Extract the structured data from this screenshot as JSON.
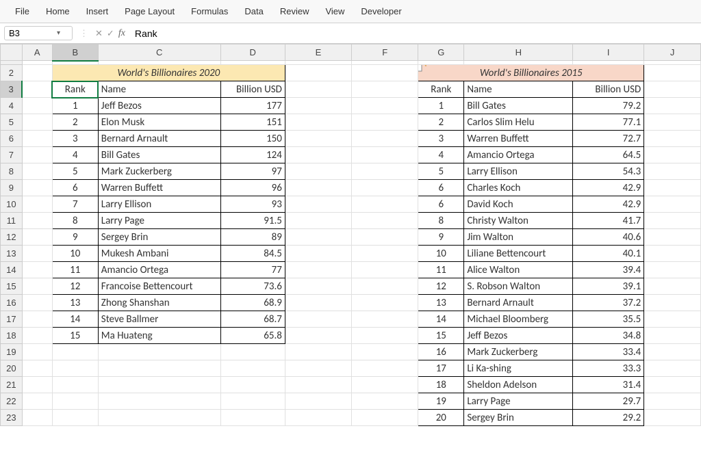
{
  "ribbon": [
    "File",
    "Home",
    "Insert",
    "Page Layout",
    "Formulas",
    "Data",
    "Review",
    "View",
    "Developer"
  ],
  "namebox": "B3",
  "formula": "Rank",
  "columns": [
    "A",
    "B",
    "C",
    "D",
    "E",
    "F",
    "G",
    "H",
    "I",
    "J"
  ],
  "selectedCell": "B3",
  "titles": {
    "t2020": "World's Billionaires 2020",
    "t2015": "World's Billionaires 2015"
  },
  "headers": {
    "rank": "Rank",
    "name": "Name",
    "usd": "Billion USD"
  },
  "table2020": [
    {
      "r": 1,
      "n": "Jeff Bezos",
      "v": "177"
    },
    {
      "r": 2,
      "n": "Elon Musk",
      "v": "151"
    },
    {
      "r": 3,
      "n": "Bernard Arnault",
      "v": "150"
    },
    {
      "r": 4,
      "n": "Bill Gates",
      "v": "124"
    },
    {
      "r": 5,
      "n": "Mark Zuckerberg",
      "v": "97"
    },
    {
      "r": 6,
      "n": "Warren Buffett",
      "v": "96"
    },
    {
      "r": 7,
      "n": "Larry Ellison",
      "v": "93"
    },
    {
      "r": 8,
      "n": "Larry Page",
      "v": "91.5"
    },
    {
      "r": 9,
      "n": "Sergey Brin",
      "v": "89"
    },
    {
      "r": 10,
      "n": "Mukesh Ambani",
      "v": "84.5"
    },
    {
      "r": 11,
      "n": "Amancio Ortega",
      "v": "77"
    },
    {
      "r": 12,
      "n": "Francoise Bettencourt",
      "v": "73.6"
    },
    {
      "r": 13,
      "n": "Zhong Shanshan",
      "v": "68.9"
    },
    {
      "r": 14,
      "n": "Steve Ballmer",
      "v": "68.7"
    },
    {
      "r": 15,
      "n": "Ma Huateng",
      "v": "65.8"
    }
  ],
  "table2015": [
    {
      "r": 1,
      "n": "Bill Gates",
      "v": "79.2"
    },
    {
      "r": 2,
      "n": "Carlos Slim Helu",
      "v": "77.1"
    },
    {
      "r": 3,
      "n": "Warren Buffett",
      "v": "72.7"
    },
    {
      "r": 4,
      "n": "Amancio Ortega",
      "v": "64.5"
    },
    {
      "r": 5,
      "n": "Larry Ellison",
      "v": "54.3"
    },
    {
      "r": 6,
      "n": "Charles Koch",
      "v": "42.9"
    },
    {
      "r": 6,
      "n": "David Koch",
      "v": "42.9"
    },
    {
      "r": 8,
      "n": "Christy Walton",
      "v": "41.7"
    },
    {
      "r": 9,
      "n": "Jim Walton",
      "v": "40.6"
    },
    {
      "r": 10,
      "n": "Liliane Bettencourt",
      "v": "40.1"
    },
    {
      "r": 11,
      "n": "Alice Walton",
      "v": "39.4"
    },
    {
      "r": 12,
      "n": "S. Robson Walton",
      "v": "39.1"
    },
    {
      "r": 13,
      "n": "Bernard Arnault",
      "v": "37.2"
    },
    {
      "r": 14,
      "n": "Michael Bloomberg",
      "v": "35.5"
    },
    {
      "r": 15,
      "n": "Jeff Bezos",
      "v": "34.8"
    },
    {
      "r": 16,
      "n": "Mark Zuckerberg",
      "v": "33.4"
    },
    {
      "r": 17,
      "n": "Li Ka-shing",
      "v": "33.3"
    },
    {
      "r": 18,
      "n": "Sheldon Adelson",
      "v": "31.4"
    },
    {
      "r": 19,
      "n": "Larry Page",
      "v": "29.7"
    },
    {
      "r": 20,
      "n": "Sergey Brin",
      "v": "29.2"
    }
  ]
}
